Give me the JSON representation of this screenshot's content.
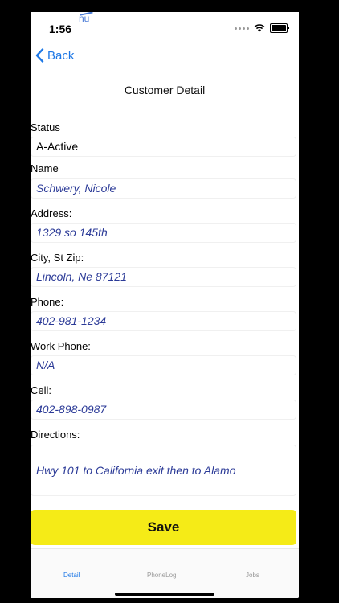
{
  "status_bar": {
    "time": "1:56",
    "ghost_text": "nu"
  },
  "nav": {
    "back_label": "Back"
  },
  "page": {
    "title": "Customer Detail"
  },
  "form": {
    "status_label": "Status",
    "status_value": "A-Active",
    "name_label": "Name",
    "name_value": "Schwery, Nicole",
    "address_label": "Address:",
    "address_value": "1329 so 145th",
    "city_label": "City, St Zip:",
    "city_value": "Lincoln, Ne 87121",
    "phone_label": "Phone:",
    "phone_value": "402-981-1234",
    "work_phone_label": "Work Phone:",
    "work_phone_value": "N/A",
    "cell_label": "Cell:",
    "cell_value": "402-898-0987",
    "directions_label": "Directions:",
    "directions_value": "Hwy 101 to California exit then to Alamo"
  },
  "save_label": "Save",
  "tabs": [
    {
      "label": "Detail",
      "active": true
    },
    {
      "label": "PhoneLog",
      "active": false
    },
    {
      "label": "Jobs",
      "active": false
    }
  ],
  "colors": {
    "accent": "#1e78e6",
    "save_button": "#f5eb17",
    "field_text": "#2b3a97"
  }
}
